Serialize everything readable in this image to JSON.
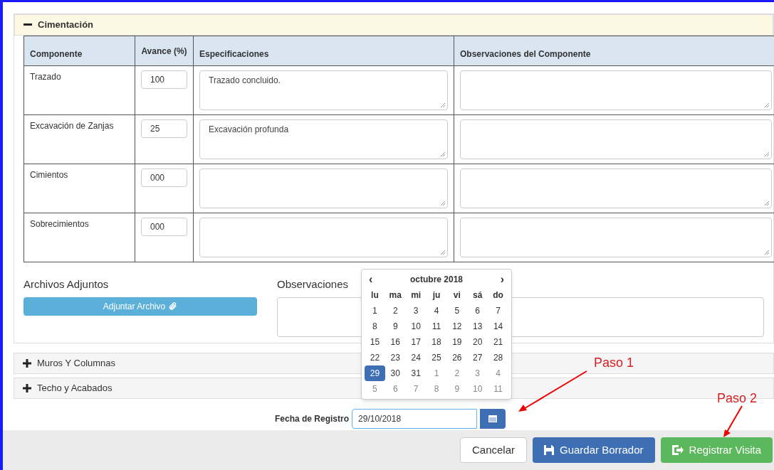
{
  "sections": [
    {
      "title": "Cimentación",
      "expanded": true
    },
    {
      "title": "Muros Y Columnas",
      "expanded": false
    },
    {
      "title": "Techo y Acabados",
      "expanded": false
    }
  ],
  "table": {
    "columns": [
      "Componente",
      "Avance (%)",
      "Especificaciones",
      "Observaciones del Componente"
    ],
    "rows": [
      {
        "component": "Trazado",
        "progress": "100",
        "specs": "Trazado concluido."
      },
      {
        "component": "Excavación de Zanjas",
        "progress": "25",
        "specs": "Excavación profunda"
      },
      {
        "component": "Cimientos",
        "progress": "000"
      },
      {
        "component": "Sobrecimientos",
        "progress": "000"
      }
    ]
  },
  "attachments": {
    "label": "Archivos Adjuntos",
    "button": "Adjuntar Archivo"
  },
  "observations": {
    "label": "Observaciones"
  },
  "date_field": {
    "label": "Fecha de Registro",
    "value": "29/10/2018"
  },
  "datepicker": {
    "prev": "‹",
    "next": "›",
    "month": "octubre 2018",
    "weekdays": [
      "lu",
      "ma",
      "mi",
      "ju",
      "vi",
      "sá",
      "do"
    ],
    "days": [
      {
        "label": "1",
        "other_month": false,
        "selected": false
      },
      {
        "label": "2",
        "other_month": false,
        "selected": false
      },
      {
        "label": "3",
        "other_month": false,
        "selected": false
      },
      {
        "label": "4",
        "other_month": false,
        "selected": false
      },
      {
        "label": "5",
        "other_month": false,
        "selected": false
      },
      {
        "label": "6",
        "other_month": false,
        "selected": false
      },
      {
        "label": "7",
        "other_month": false,
        "selected": false
      },
      {
        "label": "8",
        "other_month": false,
        "selected": false
      },
      {
        "label": "9",
        "other_month": false,
        "selected": false
      },
      {
        "label": "10",
        "other_month": false,
        "selected": false
      },
      {
        "label": "11",
        "other_month": false,
        "selected": false
      },
      {
        "label": "12",
        "other_month": false,
        "selected": false
      },
      {
        "label": "13",
        "other_month": false,
        "selected": false
      },
      {
        "label": "14",
        "other_month": false,
        "selected": false
      },
      {
        "label": "15",
        "other_month": false,
        "selected": false
      },
      {
        "label": "16",
        "other_month": false,
        "selected": false
      },
      {
        "label": "17",
        "other_month": false,
        "selected": false
      },
      {
        "label": "18",
        "other_month": false,
        "selected": false
      },
      {
        "label": "19",
        "other_month": false,
        "selected": false
      },
      {
        "label": "20",
        "other_month": false,
        "selected": false
      },
      {
        "label": "21",
        "other_month": false,
        "selected": false
      },
      {
        "label": "22",
        "other_month": false,
        "selected": false
      },
      {
        "label": "23",
        "other_month": false,
        "selected": false
      },
      {
        "label": "24",
        "other_month": false,
        "selected": false
      },
      {
        "label": "25",
        "other_month": false,
        "selected": false
      },
      {
        "label": "26",
        "other_month": false,
        "selected": false
      },
      {
        "label": "27",
        "other_month": false,
        "selected": false
      },
      {
        "label": "28",
        "other_month": false,
        "selected": false
      },
      {
        "label": "29",
        "other_month": false,
        "selected": true
      },
      {
        "label": "30",
        "other_month": false,
        "selected": false
      },
      {
        "label": "31",
        "other_month": false,
        "selected": false
      },
      {
        "label": "1",
        "other_month": true,
        "selected": false
      },
      {
        "label": "2",
        "other_month": true,
        "selected": false
      },
      {
        "label": "3",
        "other_month": true,
        "selected": false
      },
      {
        "label": "4",
        "other_month": true,
        "selected": false
      },
      {
        "label": "5",
        "other_month": true,
        "selected": false
      },
      {
        "label": "6",
        "other_month": true,
        "selected": false
      },
      {
        "label": "7",
        "other_month": true,
        "selected": false
      },
      {
        "label": "8",
        "other_month": true,
        "selected": false
      },
      {
        "label": "9",
        "other_month": true,
        "selected": false
      },
      {
        "label": "10",
        "other_month": true,
        "selected": false
      },
      {
        "label": "11",
        "other_month": true,
        "selected": false
      }
    ]
  },
  "annotations": [
    "Paso 1",
    "Paso 2"
  ],
  "buttons": [
    {
      "label": "Cancelar",
      "kind": "default"
    },
    {
      "label": "Guardar Borrador",
      "kind": "primary"
    },
    {
      "label": "Registrar Visita",
      "kind": "success"
    }
  ]
}
